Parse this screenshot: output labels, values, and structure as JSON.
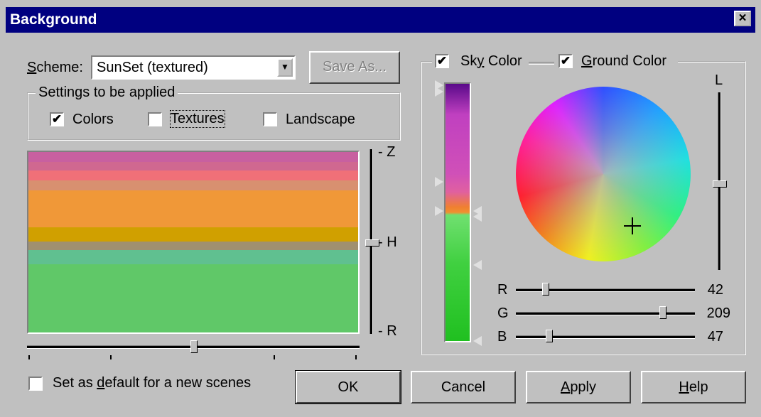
{
  "window": {
    "title": "Background",
    "close_symbol": "×"
  },
  "scheme": {
    "label": "Scheme:",
    "value": "SunSet (textured)",
    "save_as": "Save As..."
  },
  "settings": {
    "legend": "Settings to be applied",
    "colors": {
      "label": "Colors",
      "checked": true
    },
    "textures": {
      "label": "Textures",
      "checked": false
    },
    "landscape": {
      "label": "Landscape",
      "checked": false
    }
  },
  "preview": {
    "bands": [
      "#c860a0",
      "#d06890",
      "#f07078",
      "#d89070",
      "#f09838",
      "#f09030",
      "#d0a000",
      "#a09070",
      "#60c090",
      "#60c868"
    ],
    "axis_labels": {
      "top": "- Z",
      "middle": "- H",
      "bottom": "- R"
    }
  },
  "default_option": {
    "label": "Set as default for a new scenes",
    "checked": false
  },
  "color_panel": {
    "sky": {
      "label": "Sky Color",
      "checked": true
    },
    "ground": {
      "label": "Ground Color",
      "checked": true
    },
    "lightness_label": "L",
    "rgb": [
      {
        "label": "R",
        "value": "42",
        "level": 0.165
      },
      {
        "label": "G",
        "value": "209",
        "level": 0.82
      },
      {
        "label": "B",
        "value": "47",
        "level": 0.185
      }
    ]
  },
  "buttons": {
    "ok": "OK",
    "cancel": "Cancel",
    "apply": "Apply",
    "help": "Help"
  },
  "check_glyph": "✔",
  "arrow_glyph": "▼"
}
